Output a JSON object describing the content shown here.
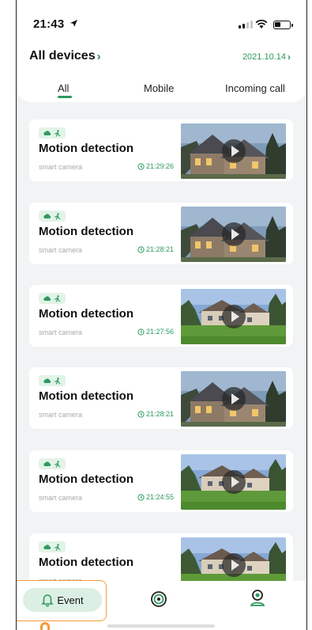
{
  "status_bar": {
    "time": "21:43"
  },
  "header": {
    "title": "All devices",
    "title_chevron": "›",
    "date": "2021.10.14",
    "date_chevron": "›"
  },
  "tabs": [
    {
      "label": "All",
      "active": true
    },
    {
      "label": "Mobile",
      "active": false
    },
    {
      "label": "Incoming call",
      "active": false
    }
  ],
  "events": [
    {
      "title": "Motion detection",
      "source": "smart camera",
      "time": "21:29:26",
      "thumbnail": "house-stone-evening"
    },
    {
      "title": "Motion detection",
      "source": "smart camera",
      "time": "21:28:21",
      "thumbnail": "house-stone-evening"
    },
    {
      "title": "Motion detection",
      "source": "smart camera",
      "time": "21:27:56",
      "thumbnail": "house-lawn-day"
    },
    {
      "title": "Motion detection",
      "source": "smart camera",
      "time": "21:28:21",
      "thumbnail": "house-stone-evening"
    },
    {
      "title": "Motion detection",
      "source": "smart camera",
      "time": "21:24:55",
      "thumbnail": "house-lawn-day"
    },
    {
      "title": "Motion detection",
      "source": "smart camera",
      "time": "",
      "thumbnail": "house-lawn-day"
    }
  ],
  "bottom_nav": {
    "event_label": "Event",
    "icons": [
      "bell-icon",
      "camera-lens-icon",
      "user-profile-icon"
    ]
  },
  "colors": {
    "accent": "#2d9a5f",
    "badge_bg": "#e2f3e8",
    "background": "#f2f3f5",
    "highlight": "#f39a3a"
  }
}
